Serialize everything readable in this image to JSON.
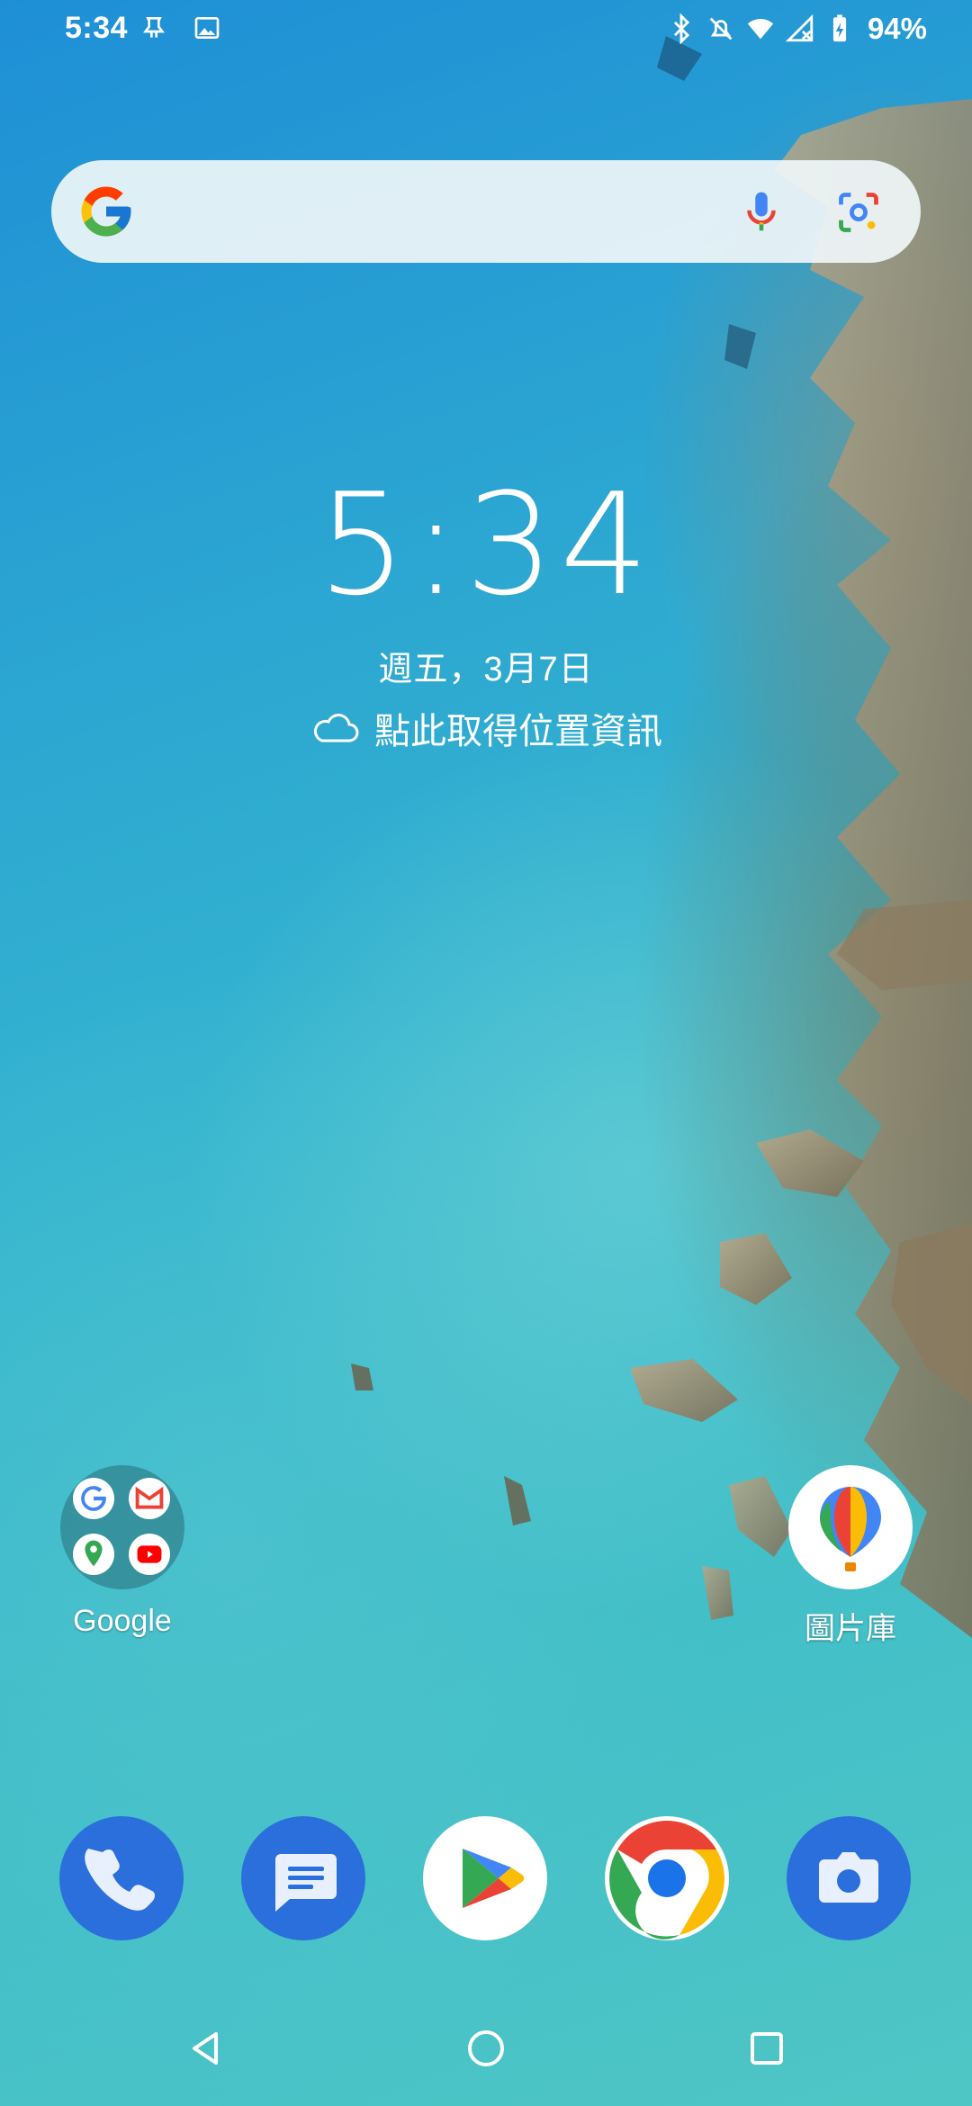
{
  "status_bar": {
    "time": "5:34",
    "battery": "94%",
    "left_icons": [
      "notification-bell-icon",
      "image-icon"
    ],
    "right_icons": [
      "bluetooth-icon",
      "mute-icon",
      "wifi-icon",
      "signal-no-service-icon",
      "battery-charging-icon"
    ]
  },
  "search_bar": {
    "logo": "google-g-icon",
    "mic": "mic-icon",
    "lens": "google-lens-icon"
  },
  "clock_widget": {
    "time": "5:34",
    "date": "週五，3月7日",
    "weather_text": "點此取得位置資訊",
    "weather_icon": "cloud-icon"
  },
  "home_apps": [
    {
      "label": "Google",
      "icon": "google-folder-icon"
    },
    {
      "label": "圖片庫",
      "icon": "gallery-balloon-icon"
    }
  ],
  "dock": [
    {
      "name": "phone",
      "icon": "phone-icon",
      "color": "#2a6fdb"
    },
    {
      "name": "messages",
      "icon": "messages-icon",
      "color": "#2a6fdb"
    },
    {
      "name": "play-store",
      "icon": "play-store-icon",
      "color": "#ffffff"
    },
    {
      "name": "chrome",
      "icon": "chrome-icon",
      "color": "#ffffff"
    },
    {
      "name": "camera",
      "icon": "camera-icon",
      "color": "#2a6fdb"
    }
  ],
  "nav": [
    "back-icon",
    "home-icon",
    "recents-icon"
  ]
}
